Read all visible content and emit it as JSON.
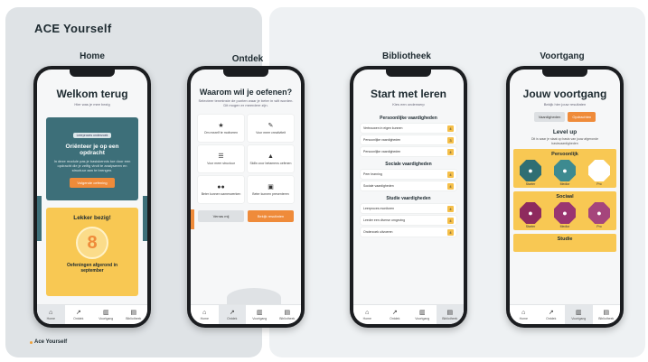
{
  "brand": "ACE Yourself",
  "footer_brand": "Ace Yourself",
  "columns": [
    "Home",
    "Ontdek",
    "Bibliotheek",
    "Voortgang"
  ],
  "tabs": [
    {
      "label": "Home",
      "icon": "home-icon"
    },
    {
      "label": "Ontdek",
      "icon": "compass-icon"
    },
    {
      "label": "Voortgang",
      "icon": "progress-icon"
    },
    {
      "label": "Bibliotheek",
      "icon": "library-icon"
    }
  ],
  "home": {
    "title": "Welkom terug",
    "subtitle": "Hier was je mee bezig",
    "card": {
      "tag": "Leerproces onderzoek",
      "title": "Oriënteer je op een opdracht",
      "desc": "In deze module pas je basiskennis toe door een opdracht die je zelfig vindt te analyseren en structuur aan te brengen.",
      "button": "Volgende oefening"
    },
    "stats": {
      "title": "Lekker bezig!",
      "number": "8",
      "desc": "Oefeningen afgerond in september"
    }
  },
  "ontdek": {
    "title": "Waarom wil je oefenen?",
    "subtitle": "Selecteer tenminste de punten waar je beter in wilt worden. Dit mogen er meerdere zijn.",
    "cells": [
      {
        "icon": "star-icon",
        "label": "Om mezelf te motiveren"
      },
      {
        "icon": "pencil-icon",
        "label": "Voor meer creativiteit"
      },
      {
        "icon": "list-icon",
        "label": "Voor meer structuur"
      },
      {
        "icon": "graduation-icon",
        "label": "Skills voor betamens oefenen"
      },
      {
        "icon": "people-icon",
        "label": "Beter kunnen samenwerken"
      },
      {
        "icon": "presentation-icon",
        "label": "Beter kunnen presenteren"
      }
    ],
    "btn_secondary": "Verras mij",
    "btn_primary": "Bekijk resultaten"
  },
  "bibliotheek": {
    "title": "Start met leren",
    "subtitle": "Kies een onderwerp",
    "sections": [
      {
        "heading": "Persoonlijke vaardigheden",
        "items": [
          {
            "label": "Vertrouwen in eigen kunnen",
            "count": "4"
          },
          {
            "label": "Persoonlijke vaardigheden",
            "count": "3"
          },
          {
            "label": "Persoonlijke vaardigheden",
            "count": "4"
          }
        ]
      },
      {
        "heading": "Sociale vaardigheden",
        "items": [
          {
            "label": "Peer learning",
            "count": "4"
          },
          {
            "label": "Sociale vaardigheden",
            "count": "4"
          }
        ]
      },
      {
        "heading": "Studie vaardigheden",
        "items": [
          {
            "label": "Leerproces monitoren",
            "count": "4"
          },
          {
            "label": "Leeder een diverse omgeving",
            "count": "4"
          },
          {
            "label": "Onderzoek uitvoeren",
            "count": "4"
          }
        ]
      }
    ]
  },
  "voortgang": {
    "title": "Jouw voortgang",
    "subtitle": "Bekijk hier jouw resultaten",
    "seg_a": "Vaardigheden",
    "seg_b": "Opdrachten",
    "level_title": "Level up",
    "level_desc": "Dit is waar je staat op basis van jouw afgeronde basisvaardigheden",
    "bands": [
      {
        "heading": "Persoonlijk",
        "badges": [
          {
            "label": "Starter",
            "color": "#2f6e73"
          },
          {
            "label": "Medior",
            "color": "#3d8a90"
          },
          {
            "label": "Pro",
            "color": "#ffffff"
          }
        ]
      },
      {
        "heading": "Sociaal",
        "badges": [
          {
            "label": "Starter",
            "color": "#8e2a5e"
          },
          {
            "label": "Medior",
            "color": "#9a3570"
          },
          {
            "label": "Pro",
            "color": "#a5457c"
          }
        ]
      },
      {
        "heading": "Studie",
        "badges": []
      }
    ]
  }
}
